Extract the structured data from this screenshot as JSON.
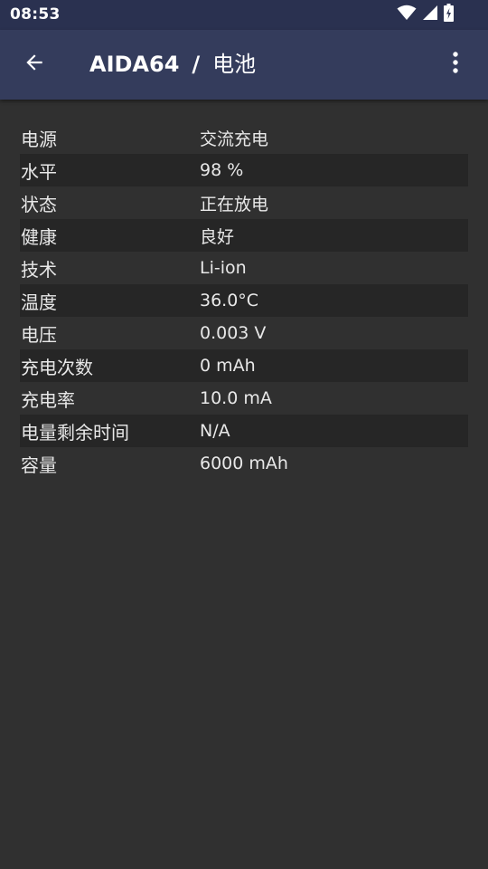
{
  "status_bar": {
    "time": "08:53",
    "icons": [
      "wifi-icon",
      "signal-icon",
      "battery-charging-icon"
    ]
  },
  "app_bar": {
    "app_name": "AIDA64",
    "separator": "/",
    "page_title": "电池",
    "back_icon": "arrow-left-icon",
    "menu_icon": "more-vert-icon"
  },
  "colors": {
    "status_bar_bg": "#2a3150",
    "app_bar_bg": "#343c5c",
    "page_bg": "#303030",
    "alt_row_bg": "#262626",
    "text": "#e8e8e8"
  },
  "battery_info": [
    {
      "label": "电源",
      "value": "交流充电"
    },
    {
      "label": "水平",
      "value": "98 %"
    },
    {
      "label": "状态",
      "value": "正在放电"
    },
    {
      "label": "健康",
      "value": "良好"
    },
    {
      "label": "技术",
      "value": "Li-ion"
    },
    {
      "label": "温度",
      "value": "36.0°C"
    },
    {
      "label": "电压",
      "value": "0.003 V"
    },
    {
      "label": "充电次数",
      "value": "0 mAh"
    },
    {
      "label": "充电率",
      "value": "10.0 mA"
    },
    {
      "label": "电量剩余时间",
      "value": "N/A"
    },
    {
      "label": "容量",
      "value": "6000 mAh"
    }
  ]
}
